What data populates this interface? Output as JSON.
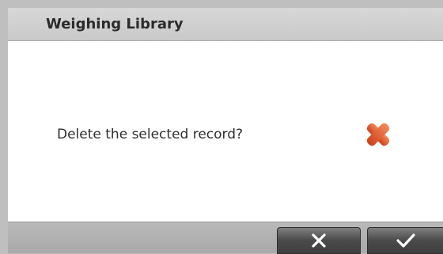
{
  "dialog": {
    "title": "Weighing Library",
    "message": "Delete the selected record?",
    "status_icon": "delete-x-icon",
    "accent_color": "#e0552a"
  },
  "buttons": {
    "cancel": {
      "icon": "x-icon"
    },
    "confirm": {
      "icon": "checkmark-icon"
    }
  }
}
